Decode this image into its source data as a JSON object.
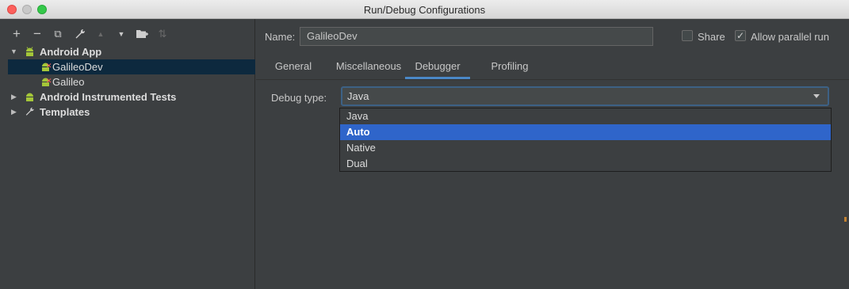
{
  "window": {
    "title": "Run/Debug Configurations"
  },
  "toolbar": {
    "buttons": [
      {
        "icon": "plus-icon",
        "glyph": "+"
      },
      {
        "icon": "minus-icon",
        "glyph": "−"
      },
      {
        "icon": "copy-icon",
        "glyph": "⧉"
      },
      {
        "icon": "wrench-icon",
        "glyph": "🔧"
      },
      {
        "icon": "move-up-icon",
        "glyph": "▲"
      },
      {
        "icon": "move-down-icon",
        "glyph": "▼"
      },
      {
        "icon": "folder-icon",
        "glyph": "▇"
      },
      {
        "icon": "sort-icon",
        "glyph": "⇅"
      }
    ]
  },
  "tree": {
    "android_app": "Android App",
    "galileodev": "GalileoDev",
    "galileo": "Galileo",
    "instrumented": "Android Instrumented Tests",
    "templates": "Templates"
  },
  "form": {
    "name_label": "Name:",
    "name_value": "GalileoDev",
    "share_label": "Share",
    "parallel_label": "Allow parallel run",
    "share_checked": false,
    "parallel_checked": true
  },
  "tabs": {
    "general": "General",
    "misc": "Miscellaneous",
    "debugger": "Debugger",
    "profiling": "Profiling",
    "active": "Debugger"
  },
  "debugger": {
    "label": "Debug type:",
    "selected": "Java",
    "options": [
      "Java",
      "Auto",
      "Native",
      "Dual"
    ],
    "highlighted": "Auto"
  },
  "colors": {
    "android_green": "#a4c639",
    "selection": "#0d293e",
    "highlight": "#2f65ca",
    "tab_underline": "#4a88c7"
  }
}
